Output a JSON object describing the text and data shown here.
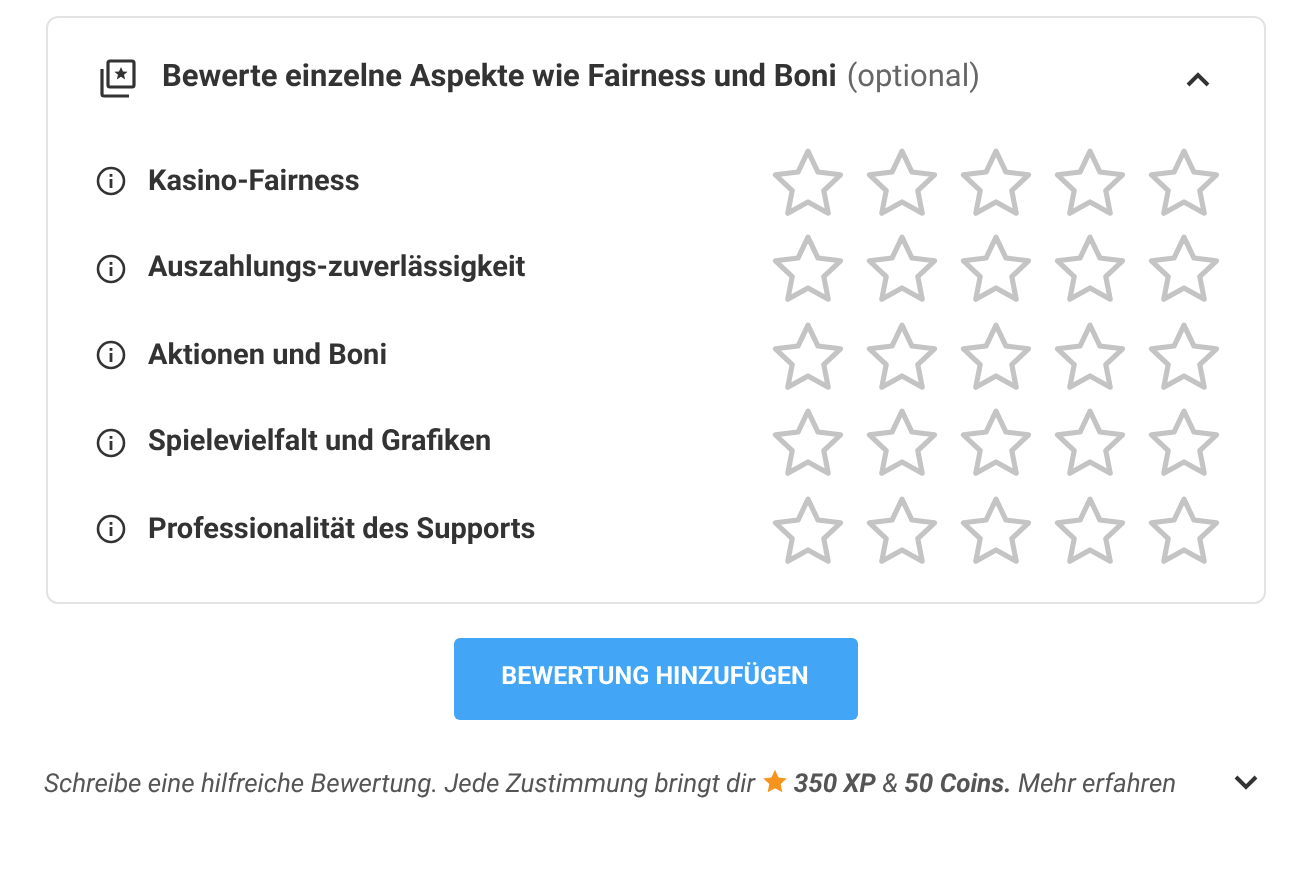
{
  "panel": {
    "title": "Bewerte einzelne Aspekte wie Fairness und Boni",
    "note": "(optional)",
    "expanded": true,
    "aspects": [
      {
        "label": "Kasino-Fairness",
        "stars": 0
      },
      {
        "label": "Auszahlungs-zuverlässigkeit",
        "stars": 0
      },
      {
        "label": "Aktionen und Boni",
        "stars": 0
      },
      {
        "label": "Spielevielfalt und Grafiken",
        "stars": 0
      },
      {
        "label": "Professionalität des Supports",
        "stars": 0
      }
    ]
  },
  "submit_button": "BEWERTUNG HINZUFÜGEN",
  "footer": {
    "text_before": "Schreibe eine hilfreiche Bewertung. Jede Zustimmung bringt dir",
    "text_after": "**350 XP**  & **50 Coins.** Mehr erfahren",
    "expanded": false
  }
}
